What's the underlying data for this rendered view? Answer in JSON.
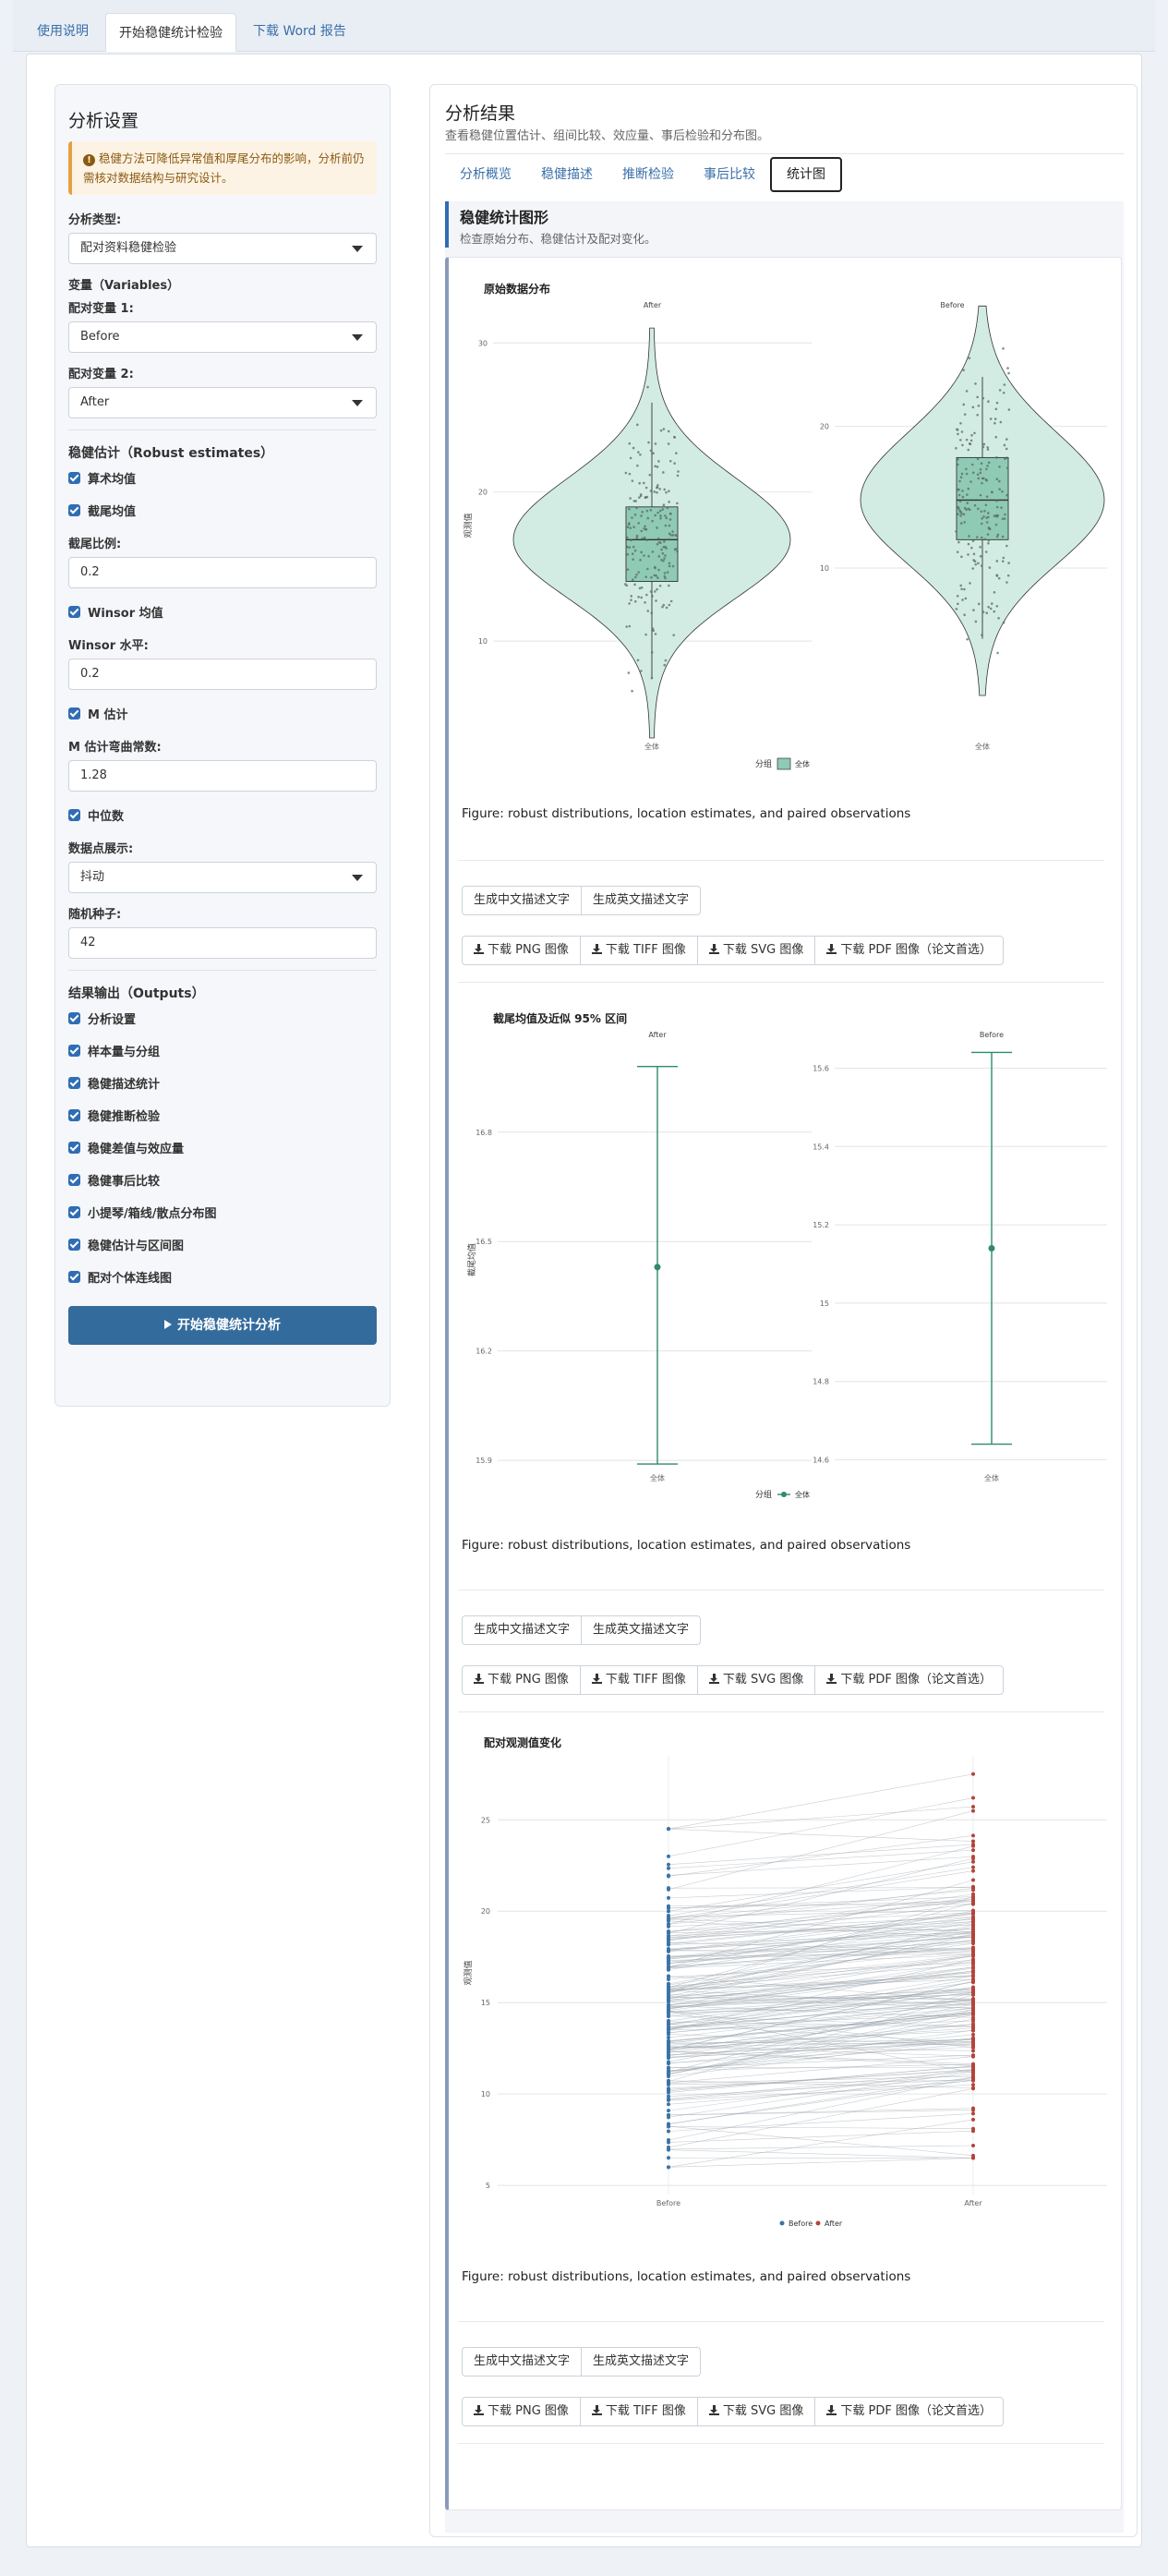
{
  "top_tabs": [
    "使用说明",
    "开始稳健统计检验",
    "下载 Word 报告"
  ],
  "sidebar": {
    "title": "分析设置",
    "alert": "稳健方法可降低异常值和厚尾分布的影响，分析前仍需核对数据结构与研究设计。",
    "analysis_type_label": "分析类型:",
    "analysis_type_value": "配对资料稳健检验",
    "variables_label": "变量（Variables）",
    "var1_label": "配对变量 1:",
    "var1_value": "Before",
    "var2_label": "配对变量 2:",
    "var2_value": "After",
    "robust_label": "稳健估计（Robust estimates）",
    "cb_mean": "算术均值",
    "cb_trim": "截尾均值",
    "trim_label": "截尾比例:",
    "trim_value": "0.2",
    "cb_winsor": "Winsor 均值",
    "winsor_label": "Winsor 水平:",
    "winsor_value": "0.2",
    "cb_m": "M 估计",
    "m_label": "M 估计弯曲常数:",
    "m_value": "1.28",
    "cb_median": "中位数",
    "points_label": "数据点展示:",
    "points_value": "抖动",
    "seed_label": "随机种子:",
    "seed_value": "42",
    "outputs_label": "结果输出（Outputs）",
    "outputs": [
      "分析设置",
      "样本量与分组",
      "稳健描述统计",
      "稳健推断检验",
      "稳健差值与效应量",
      "稳健事后比较",
      "小提琴/箱线/散点分布图",
      "稳健估计与区间图",
      "配对个体连线图"
    ],
    "run_button": "开始稳健统计分析"
  },
  "main": {
    "title": "分析结果",
    "subtitle": "查看稳健位置估计、组间比较、效应量、事后检验和分布图。",
    "tabs": [
      "分析概览",
      "稳健描述",
      "推断检验",
      "事后比较",
      "统计图"
    ],
    "panel_title": "稳健统计图形",
    "panel_subtitle": "检查原始分布、稳健估计及配对变化。",
    "caption": "Figure: robust distributions, location estimates, and paired observations",
    "text_buttons": [
      "生成中文描述文字",
      "生成英文描述文字"
    ],
    "download_buttons": [
      "下载 PNG 图像",
      "下载 TIFF 图像",
      "下载 SVG 图像",
      "下载 PDF 图像（论文首选）"
    ]
  },
  "chart_data": [
    {
      "type": "violin",
      "title": "原始数据分布",
      "facets": [
        "After",
        "Before"
      ],
      "ylabel": "观测值",
      "x_tick": "全体",
      "legend_title": "分组",
      "legend_entry": "全体",
      "panels": [
        {
          "name": "After",
          "yticks": [
            10,
            20,
            30
          ],
          "ylim": [
            3.5,
            32
          ],
          "q1": 14,
          "median": 16.8,
          "q3": 19,
          "whisker_low": 7.5,
          "whisker_high": 26
        },
        {
          "name": "Before",
          "yticks": [
            10,
            20
          ],
          "ylim": [
            -2,
            28
          ],
          "q1": 12,
          "median": 14.8,
          "q3": 17.8,
          "whisker_low": 5,
          "whisker_high": 23.5
        }
      ],
      "fill_color": "#d2ece3",
      "box_color": "#8fcab4"
    },
    {
      "type": "errorbar",
      "title": "截尾均值及近似 95% 区间",
      "facets": [
        "After",
        "Before"
      ],
      "ylabel": "截尾均值",
      "x_tick": "全体",
      "legend_title": "分组",
      "legend_entry": "全体",
      "panels": [
        {
          "name": "After",
          "yticks": [
            15.9,
            16.2,
            16.5,
            16.8
          ],
          "ylim": [
            15.88,
            17.04
          ],
          "estimate": 16.43,
          "lower": 15.89,
          "upper": 16.98
        },
        {
          "name": "Before",
          "yticks": [
            14.6,
            14.8,
            15.0,
            15.2,
            15.4,
            15.6
          ],
          "ylim": [
            14.58,
            15.66
          ],
          "estimate": 15.14,
          "lower": 14.64,
          "upper": 15.64
        }
      ],
      "color": "#2e8b6d"
    },
    {
      "type": "paired-lines",
      "title": "配对观测值变化",
      "categories": [
        "Before",
        "After"
      ],
      "ylabel": "观测值",
      "yticks": [
        5,
        10,
        15,
        20,
        25
      ],
      "ylim": [
        4.5,
        28.5
      ],
      "legend": [
        "Before",
        "After"
      ],
      "colors": {
        "Before": "#3b74a6",
        "After": "#b5433a"
      },
      "n_pairs": 200,
      "before_range": [
        6,
        24.5
      ],
      "after_range": [
        6.5,
        27.5
      ]
    }
  ]
}
